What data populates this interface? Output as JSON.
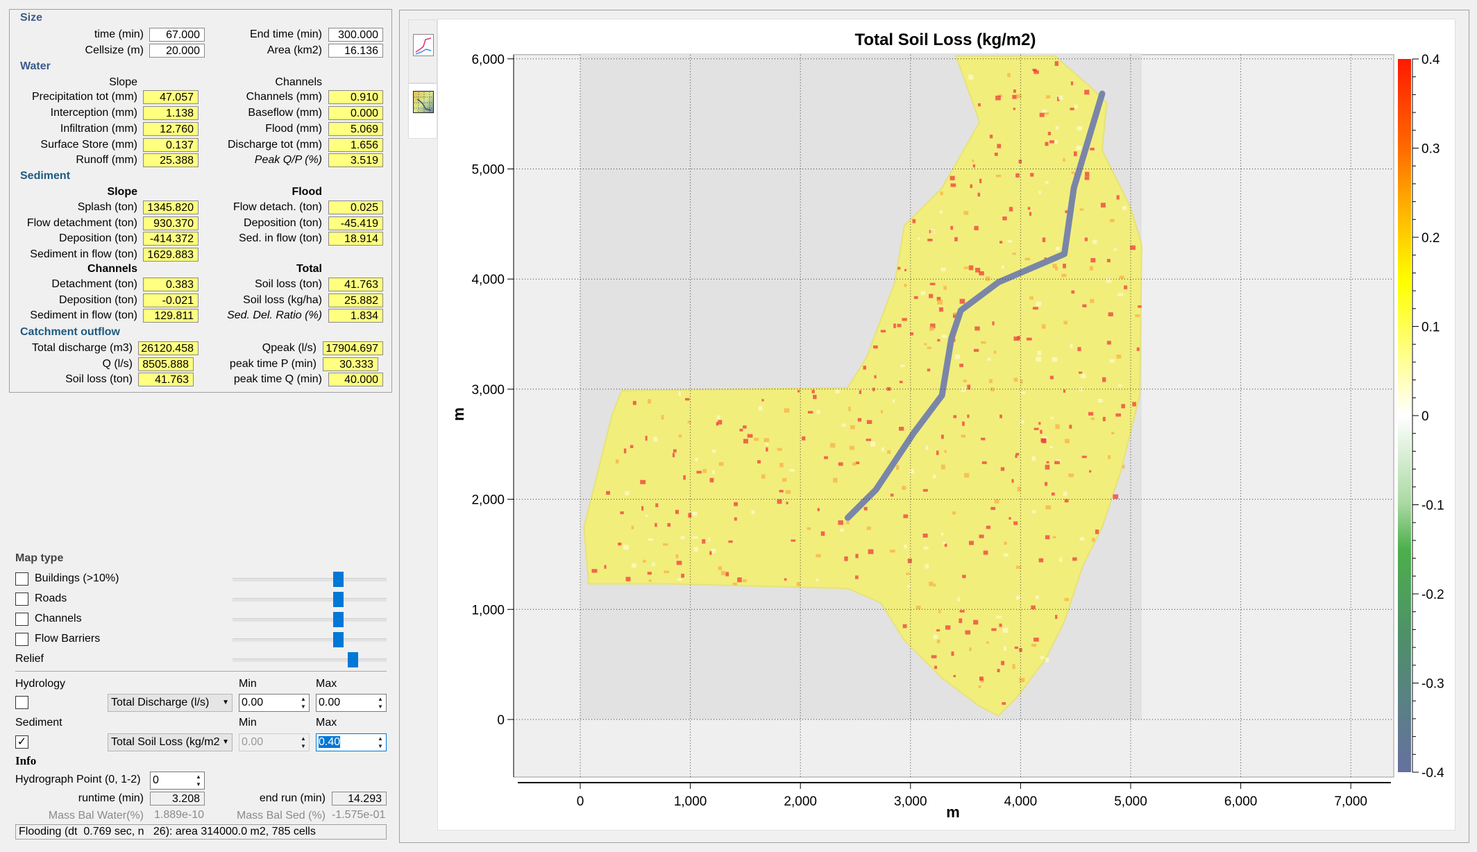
{
  "stats": {
    "size": {
      "title": "Size",
      "left": [
        {
          "label": "time (min)",
          "value": "67.000"
        },
        {
          "label": "Cellsize (m)",
          "value": "20.000"
        }
      ],
      "right": [
        {
          "label": "End time (min)",
          "value": "300.000"
        },
        {
          "label": "Area (km2)",
          "value": "16.136"
        }
      ]
    },
    "water": {
      "title": "Water",
      "left_header": "Slope",
      "right_header": "Channels",
      "left": [
        {
          "label": "Precipitation tot (mm)",
          "value": "47.057"
        },
        {
          "label": "Interception (mm)",
          "value": "1.138"
        },
        {
          "label": "Infiltration (mm)",
          "value": "12.760"
        },
        {
          "label": "Surface Store (mm)",
          "value": "0.137"
        },
        {
          "label": "Runoff (mm)",
          "value": "25.388"
        }
      ],
      "right": [
        {
          "label": "Channels (mm)",
          "value": "0.910"
        },
        {
          "label": "Baseflow (mm)",
          "value": "0.000"
        },
        {
          "label": "Flood (mm)",
          "value": "5.069"
        },
        {
          "label": "Discharge tot (mm)",
          "value": "1.656"
        },
        {
          "label": "Peak Q/P (%)",
          "value": "3.519"
        }
      ]
    },
    "sediment": {
      "title": "Sediment",
      "slope_header": "Slope",
      "flood_header": "Flood",
      "slope": [
        {
          "label": "Splash (ton)",
          "value": "1345.820"
        },
        {
          "label": "Flow detachment (ton)",
          "value": "930.370"
        },
        {
          "label": "Deposition (ton)",
          "value": "-414.372"
        },
        {
          "label": "Sediment in flow (ton)",
          "value": "1629.883"
        }
      ],
      "flood": [
        {
          "label": "Flow detach. (ton)",
          "value": "0.025"
        },
        {
          "label": "Deposition (ton)",
          "value": "-45.419"
        },
        {
          "label": "Sed. in flow (ton)",
          "value": "18.914"
        }
      ],
      "channels_header": "Channels",
      "total_header": "Total",
      "channels": [
        {
          "label": "Detachment (ton)",
          "value": "0.383"
        },
        {
          "label": "Deposition (ton)",
          "value": "-0.021"
        },
        {
          "label": "Sediment in flow (ton)",
          "value": "129.811"
        }
      ],
      "total": [
        {
          "label": "Soil loss (ton)",
          "value": "41.763"
        },
        {
          "label": "Soil loss (kg/ha)",
          "value": "25.882"
        },
        {
          "label": "Sed. Del. Ratio  (%)",
          "value": "1.834"
        }
      ]
    },
    "outflow": {
      "title": "Catchment outflow",
      "left": [
        {
          "label": "Total discharge (m3)",
          "value": "26120.458"
        },
        {
          "label": "Q (l/s)",
          "value": "8505.888"
        },
        {
          "label": "Soil loss (ton)",
          "value": "41.763"
        }
      ],
      "right": [
        {
          "label": "Qpeak (l/s)",
          "value": "17904.697"
        },
        {
          "label": "peak time P (min)",
          "value": "30.333"
        },
        {
          "label": "peak time Q (min)",
          "value": "40.000"
        }
      ]
    }
  },
  "map_type": {
    "title": "Map type",
    "layers": [
      {
        "label": "Buildings (>10%)",
        "checked": false,
        "slider": 0.7
      },
      {
        "label": "Roads",
        "checked": false,
        "slider": 0.7
      },
      {
        "label": "Channels",
        "checked": false,
        "slider": 0.7
      },
      {
        "label": "Flow Barriers",
        "checked": false,
        "slider": 0.7
      }
    ],
    "relief": {
      "label": "Relief",
      "slider": 0.8
    }
  },
  "hydrology": {
    "label": "Hydrology",
    "checked": false,
    "combo": "Total Discharge (l/s)",
    "min_label": "Min",
    "max_label": "Max",
    "min": "0.00",
    "max": "0.00"
  },
  "sediment_map": {
    "label": "Sediment",
    "checked": true,
    "check_mark": "✓",
    "combo": "Total Soil Loss (kg/m2",
    "min_label": "Min",
    "max_label": "Max",
    "min": "0.00",
    "max": "0.40"
  },
  "info": {
    "title": "Info",
    "hydrograph_label": "Hydrograph Point (0, 1-2)",
    "hydrograph_value": "0",
    "runtime_label": "runtime (min)",
    "runtime": "3.208",
    "endrun_label": "end run (min)",
    "endrun": "14.293",
    "massbal_water_label": "Mass Bal Water(%)",
    "massbal_water": "1.889e-10",
    "massbal_sed_label": "Mass Bal Sed (%)",
    "massbal_sed": "-1.575e-01",
    "flooding": "Flooding (dt  0.769 sec, n   26): area 314000.0 m2, 785 cells"
  },
  "tabs": [
    {
      "icon": "hydrograph-chart-icon"
    },
    {
      "icon": "map-view-icon",
      "active": true
    }
  ],
  "chart_data": {
    "type": "heatmap",
    "title": "Total Soil Loss (kg/m2)",
    "xlabel": "m",
    "ylabel": "m",
    "xlim": [
      -605,
      7390
    ],
    "ylim": [
      -523,
      6038
    ],
    "xticks": [
      "0",
      "1,000",
      "2,000",
      "3,000",
      "4,000",
      "5,000",
      "6,000",
      "7,000"
    ],
    "xtick_values": [
      0,
      1000,
      2000,
      3000,
      4000,
      5000,
      6000,
      7000
    ],
    "yticks": [
      "0",
      "1,000",
      "2,000",
      "3,000",
      "4,000",
      "5,000",
      "6,000"
    ],
    "ytick_values": [
      0,
      1000,
      2000,
      3000,
      4000,
      5000,
      6000
    ],
    "grid": true,
    "raster_extent": {
      "x": [
        0,
        5100
      ],
      "y": [
        0,
        6050
      ]
    },
    "catchment_outline": [
      [
        3414,
        6026
      ],
      [
        4313,
        6026
      ],
      [
        4655,
        5726
      ],
      [
        4783,
        5598
      ],
      [
        4741,
        5170
      ],
      [
        4997,
        4656
      ],
      [
        5100,
        4314
      ],
      [
        5083,
        2944
      ],
      [
        4912,
        2260
      ],
      [
        4741,
        1746
      ],
      [
        4569,
        1404
      ],
      [
        4398,
        890
      ],
      [
        4227,
        548
      ],
      [
        3970,
        205
      ],
      [
        3799,
        34
      ],
      [
        3628,
        120
      ],
      [
        3286,
        377
      ],
      [
        2944,
        719
      ],
      [
        2730,
        1061
      ],
      [
        2430,
        1190
      ],
      [
        804,
        1232
      ],
      [
        77,
        1232
      ],
      [
        34,
        1746
      ],
      [
        291,
        2773
      ],
      [
        377,
        2987
      ],
      [
        2430,
        3013
      ],
      [
        2601,
        3287
      ],
      [
        2858,
        3971
      ],
      [
        2944,
        4485
      ],
      [
        3286,
        4827
      ],
      [
        3628,
        5426
      ]
    ],
    "channel_line": [
      [
        4741,
        5683
      ],
      [
        4484,
        4827
      ],
      [
        4398,
        4228
      ],
      [
        3799,
        3971
      ],
      [
        3457,
        3715
      ],
      [
        3371,
        3458
      ],
      [
        3286,
        2944
      ],
      [
        3029,
        2602
      ],
      [
        2687,
        2088
      ],
      [
        2430,
        1832
      ]
    ],
    "colorbar": {
      "min": -0.4,
      "max": 0.4,
      "tick_labels": [
        "0.4",
        "0.3",
        "0.2",
        "0.1",
        "0",
        "-0.1",
        "-0.2",
        "-0.3",
        "-0.4"
      ],
      "tick_values": [
        0.4,
        0.3,
        0.2,
        0.1,
        0,
        -0.1,
        -0.2,
        -0.3,
        -0.4
      ],
      "colors": [
        [
          0.4,
          "#ff1a00"
        ],
        [
          0.3,
          "#ff6a00"
        ],
        [
          0.25,
          "#ffa000"
        ],
        [
          0.2,
          "#ffd000"
        ],
        [
          0.15,
          "#ffff00"
        ],
        [
          0.05,
          "#ffffa8"
        ],
        [
          0,
          "#ffffff"
        ],
        [
          -0.1,
          "#a8d8a0"
        ],
        [
          -0.15,
          "#4caf4c"
        ],
        [
          -0.25,
          "#4f8f6a"
        ],
        [
          -0.4,
          "#6670a0"
        ]
      ]
    },
    "typical_value_color": "#f2ee7c",
    "hotspot_color": "#ee3b3b",
    "channel_color": "#7a86a8",
    "background_color": "#e2e2e2"
  }
}
